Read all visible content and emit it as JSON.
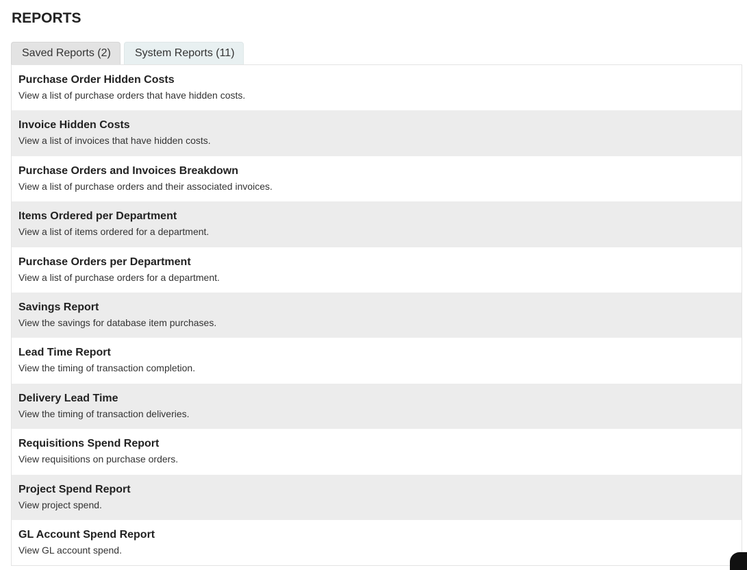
{
  "page": {
    "title": "REPORTS"
  },
  "tabs": [
    {
      "label": "Saved Reports (2)"
    },
    {
      "label": "System Reports (11)"
    }
  ],
  "reports": [
    {
      "name": "Purchase Order Hidden Costs",
      "description": "View a list of purchase orders that have hidden costs."
    },
    {
      "name": "Invoice Hidden Costs",
      "description": "View a list of invoices that have hidden costs."
    },
    {
      "name": "Purchase Orders and Invoices Breakdown",
      "description": "View a list of purchase orders and their associated invoices."
    },
    {
      "name": "Items Ordered per Department",
      "description": "View a list of items ordered for a department."
    },
    {
      "name": "Purchase Orders per Department",
      "description": "View a list of purchase orders for a department."
    },
    {
      "name": "Savings Report",
      "description": "View the savings for database item purchases."
    },
    {
      "name": "Lead Time Report",
      "description": "View the timing of transaction completion."
    },
    {
      "name": "Delivery Lead Time",
      "description": "View the timing of transaction deliveries."
    },
    {
      "name": "Requisitions Spend Report",
      "description": "View requisitions on purchase orders."
    },
    {
      "name": "Project Spend Report",
      "description": "View project spend."
    },
    {
      "name": "GL Account Spend Report",
      "description": "View GL account spend."
    }
  ]
}
